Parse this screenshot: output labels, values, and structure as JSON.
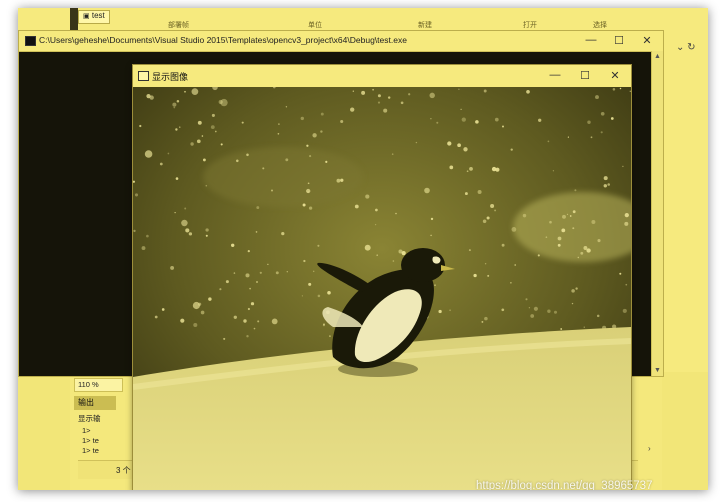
{
  "ide": {
    "tab_label": "test",
    "menu_items": [
      "部署帧",
      "单位",
      "新建",
      "打开",
      "选择"
    ],
    "zoom": "110 %",
    "output_tab": "输出",
    "output_label": "显示输",
    "output_lines": [
      "1>",
      "1>  te",
      "1>  te"
    ],
    "status": "3 个",
    "colors": {
      "tint": "#f2e678",
      "console_bg": "#151409"
    }
  },
  "console_window": {
    "title": "C:\\Users\\geheshe\\Documents\\Visual Studio 2015\\Templates\\opencv3_project\\x64\\Debug\\test.exe",
    "icon": "console-app-icon",
    "controls": {
      "minimize": "—",
      "maximize": "☐",
      "close": "✕"
    }
  },
  "image_window": {
    "title": "显示图像",
    "icon": "window-app-icon",
    "controls": {
      "minimize": "—",
      "maximize": "☐",
      "close": "✕"
    },
    "image_subject": "penguin in snowfall (yellow tinted)"
  },
  "watermark": "https://blog.csdn.net/qq_38965737"
}
